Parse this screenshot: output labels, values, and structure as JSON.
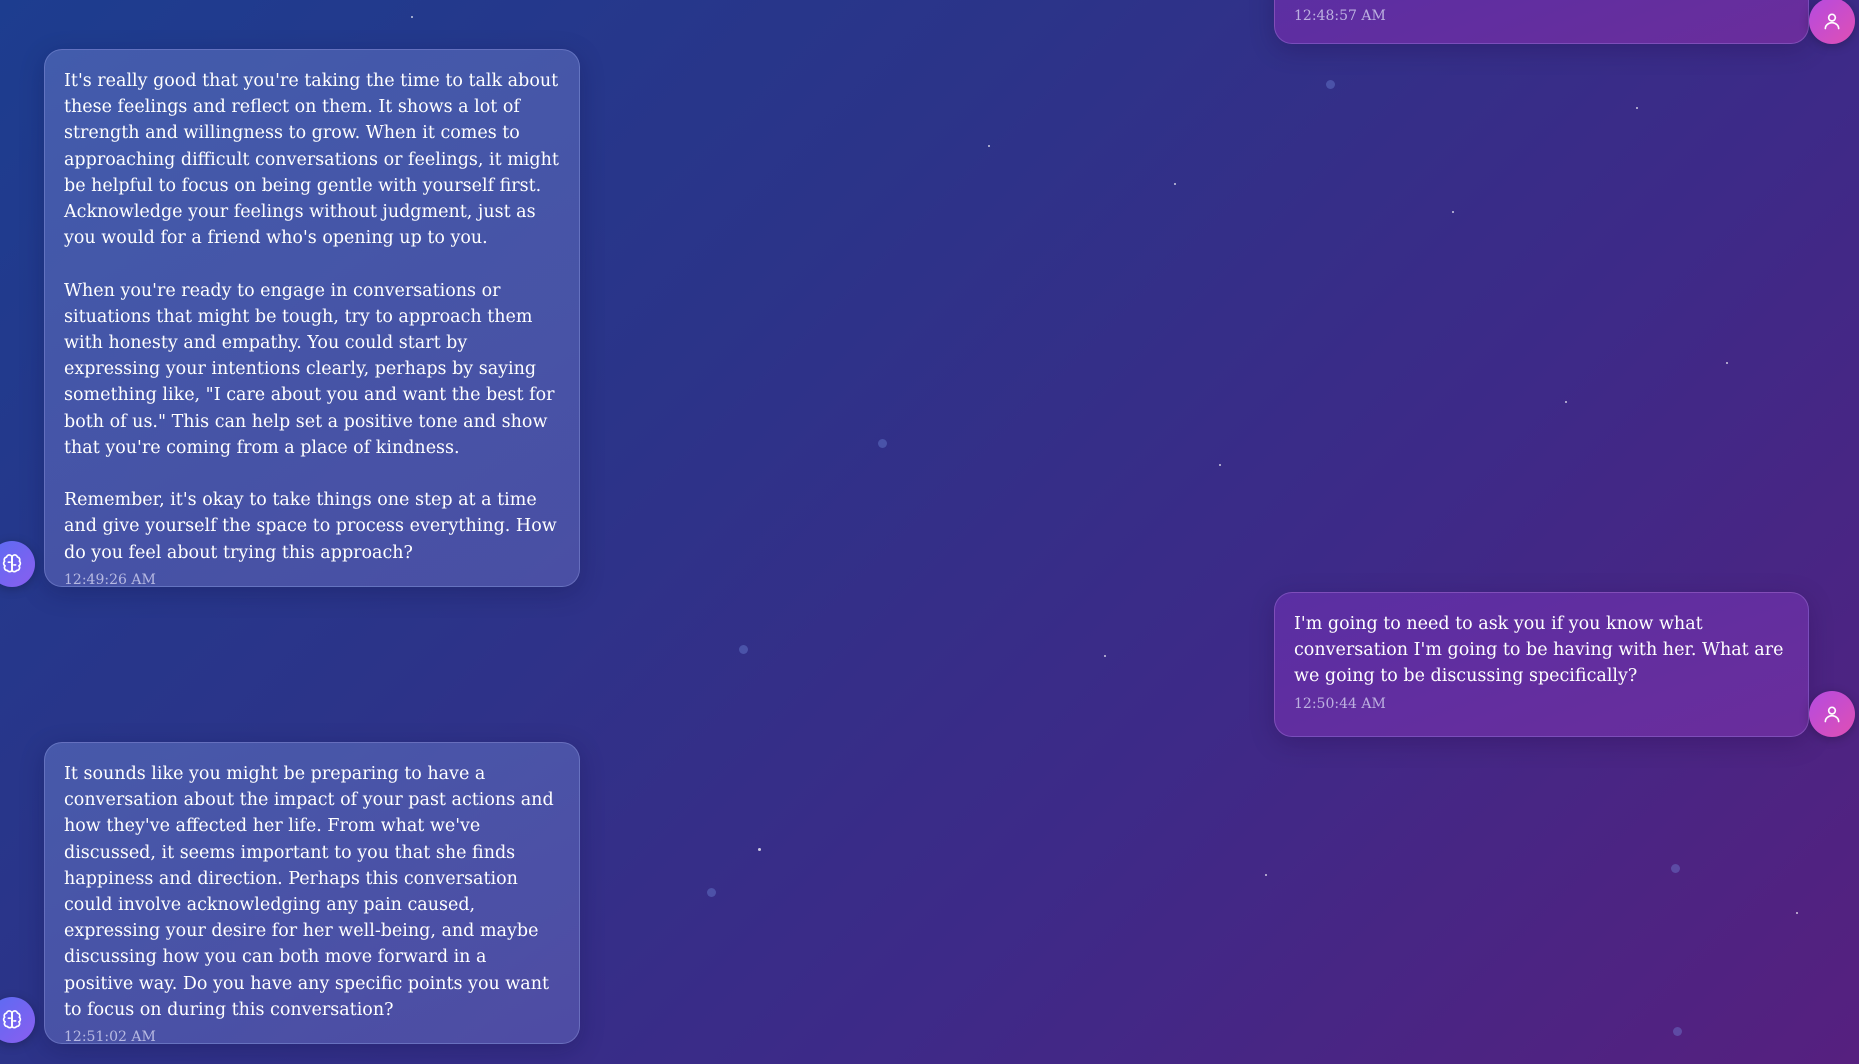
{
  "messages": [
    {
      "role": "user",
      "text": "",
      "time": "12:48:57 AM"
    },
    {
      "role": "assistant",
      "text": "It's really good that you're taking the time to talk about these feelings and reflect on them. It shows a lot of strength and willingness to grow. When it comes to approaching difficult conversations or feelings, it might be helpful to focus on being gentle with yourself first. Acknowledge your feelings without judgment, just as you would for a friend who's opening up to you.\n\nWhen you're ready to engage in conversations or situations that might be tough, try to approach them with honesty and empathy. You could start by expressing your intentions clearly, perhaps by saying something like, \"I care about you and want the best for both of us.\" This can help set a positive tone and show that you're coming from a place of kindness.\n\nRemember, it's okay to take things one step at a time and give yourself the space to process everything. How do you feel about trying this approach?",
      "time": "12:49:26 AM"
    },
    {
      "role": "user",
      "text": "I'm going to need to ask you if you know what conversation I'm going to be having with her. What are we going to be discussing specifically?",
      "time": "12:50:44 AM"
    },
    {
      "role": "assistant",
      "text": "It sounds like you might be preparing to have a conversation about the impact of your past actions and how they've affected her life. From what we've discussed, it seems important to you that she finds happiness and direction. Perhaps this conversation could involve acknowledging any pain caused, expressing your desire for her well-being, and maybe discussing how you can both move forward in a positive way. Do you have any specific points you want to focus on during this conversation?",
      "time": "12:51:02 AM"
    }
  ],
  "icons": {
    "assistant_avatar": "brain-icon",
    "user_avatar": "user-icon"
  },
  "colors": {
    "background_start": "#1d3d8f",
    "background_end": "#56207f",
    "user_bubble": "#5a2fa3",
    "assistant_avatar": "#5a6cf2",
    "user_avatar": "#e04fb4"
  }
}
